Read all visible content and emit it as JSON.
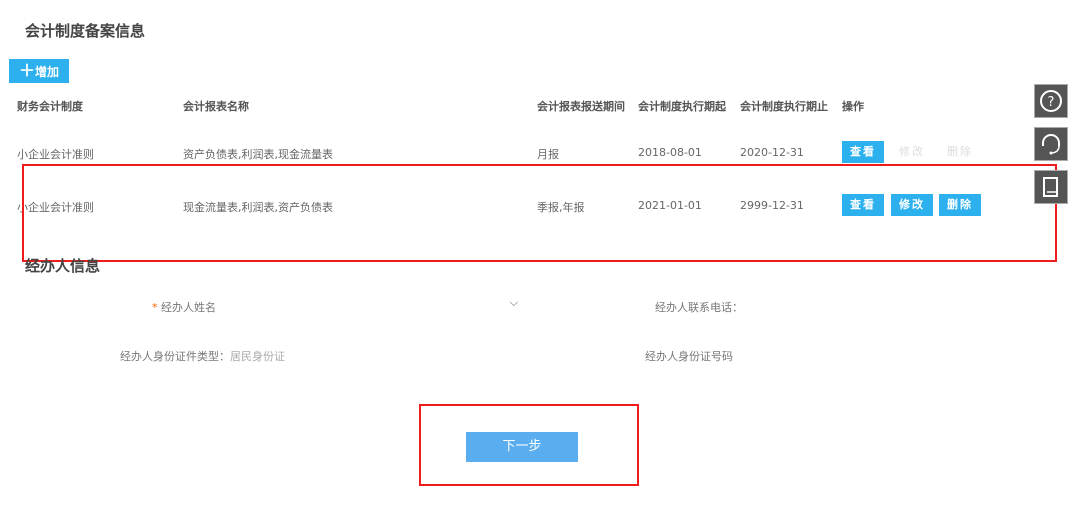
{
  "section1": {
    "title": "会计制度备案信息",
    "add_label": "增加"
  },
  "table": {
    "headers": [
      "财务会计制度",
      "会计报表名称",
      "会计报表报送期间",
      "会计制度执行期起",
      "会计制度执行期止",
      "操作"
    ],
    "rows": [
      {
        "system": "小企业会计准则",
        "reports": "资产负债表,利润表,现金流量表",
        "period": "月报",
        "start": "2018-08-01",
        "end": "2020-12-31",
        "view": "查看",
        "edit": "修改",
        "delete": "删除"
      },
      {
        "system": "小企业会计准则",
        "reports": "现金流量表,利润表,资产负债表",
        "period": "季报,年报",
        "start": "2021-01-01",
        "end": "2999-12-31",
        "view": "查看",
        "edit": "修改",
        "delete": "删除"
      }
    ]
  },
  "section2": {
    "title": "经办人信息",
    "name_label": "经办人姓名",
    "required_mark": "*",
    "phone_label": "经办人联系电话：",
    "id_type_label": "经办人身份证件类型：",
    "id_type_value": "居民身份证",
    "id_no_label": "经办人身份证号码"
  },
  "next_label": "下一步",
  "colors": {
    "accent": "#2cb0ee",
    "next": "#5aaef0",
    "highlight": "#f01c1c"
  }
}
